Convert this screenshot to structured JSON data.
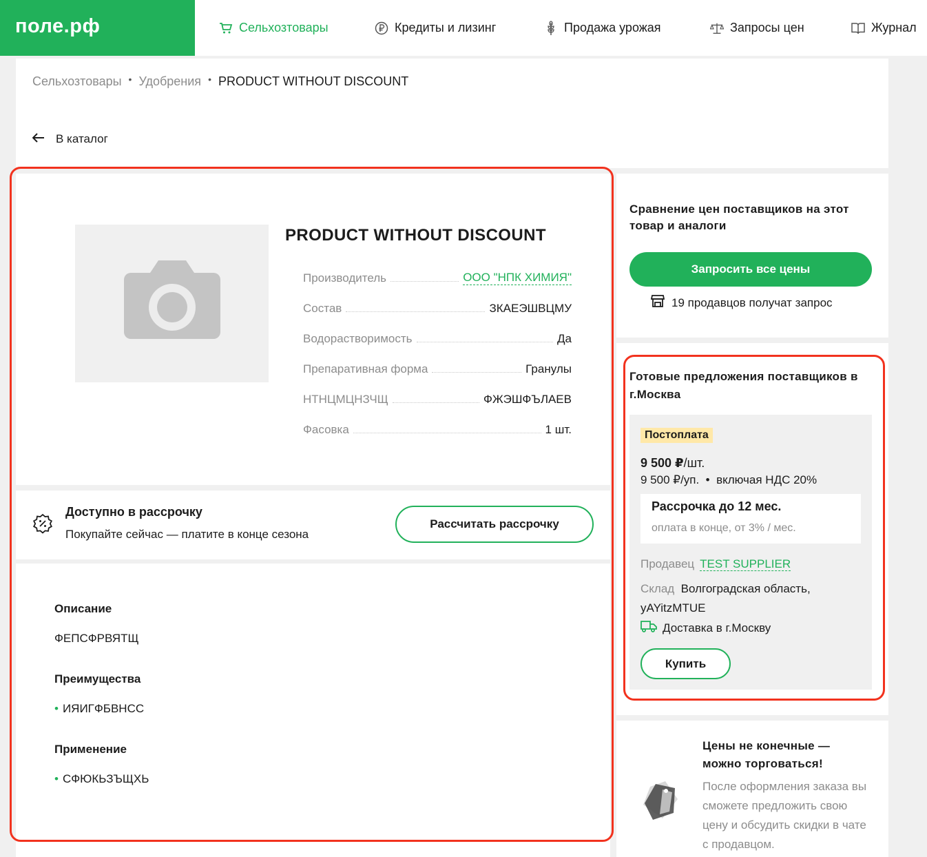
{
  "header": {
    "logo": "поле.рф",
    "nav": [
      {
        "label": "Сельхозтовары",
        "icon": "cart-icon",
        "active": true
      },
      {
        "label": "Кредиты и лизинг",
        "icon": "ruble-coin-icon"
      },
      {
        "label": "Продажа урожая",
        "icon": "wheat-icon"
      },
      {
        "label": "Запросы цен",
        "icon": "scales-icon"
      },
      {
        "label": "Журнал",
        "icon": "book-icon"
      }
    ]
  },
  "breadcrumbs": [
    "Сельхозтовары",
    "Удобрения",
    "PRODUCT WITHOUT DISCOUNT"
  ],
  "back_label": "В каталог",
  "product": {
    "title": "PRODUCT WITHOUT DISCOUNT",
    "image_placeholder": "camera-icon",
    "specs": [
      {
        "key": "Производитель",
        "value": "ООО \"НПК ХИМИЯ\"",
        "link": true
      },
      {
        "key": "Состав",
        "value": "ЗКАЕЭШВЦМУ"
      },
      {
        "key": "Водорастворимость",
        "value": "Да"
      },
      {
        "key": "Препаративная форма",
        "value": "Гранулы"
      },
      {
        "key": "НТНЦМЦНЗЧЩ",
        "value": "ФЖЭШФЪЛАЕВ"
      },
      {
        "key": "Фасовка",
        "value": "1 шт."
      }
    ]
  },
  "installment": {
    "title": "Доступно в рассрочку",
    "subtitle": "Покупайте сейчас — платите в конце сезона",
    "button": "Рассчитать рассрочку"
  },
  "details": {
    "description_h": "Описание",
    "description": "ФЕПСФРВЯТЩ",
    "advantages_h": "Преимущества",
    "advantages": [
      "ИЯИГФБВНСС"
    ],
    "usage_h": "Применение",
    "usage": [
      "СФЮКЬЗЪЩХЬ"
    ]
  },
  "compare": {
    "title": "Сравнение цен поставщиков на этот товар и аналоги",
    "button": "Запросить все цены",
    "sellers_note": "19 продавцов получат запрос"
  },
  "offers": {
    "title": "Готовые предложения поставщиков в г.Москва",
    "badge": "Постоплата",
    "price_main": "9 500 ₽",
    "price_unit": "/шт.",
    "price_pack": "9 500 ₽/уп.",
    "vat": "включая НДС 20%",
    "inst_title": "Рассрочка до 12 мес.",
    "inst_sub": "оплата в конце, от 3% / мес.",
    "seller_label": "Продавец",
    "seller": "TEST SUPPLIER",
    "stock_label": "Склад",
    "stock": "Волгоградская область, yAYitzMTUE",
    "delivery": "Доставка в г.Москву",
    "buy": "Купить"
  },
  "negotiate": {
    "title": "Цены не конечные — можно торговаться!",
    "text": "После оформления заказа вы сможете предложить свою цену и обсудить скидки в чате с продавцом."
  },
  "colors": {
    "brand": "#21b15a",
    "highlight": "#f2321e",
    "badge": "#ffe8a8"
  }
}
